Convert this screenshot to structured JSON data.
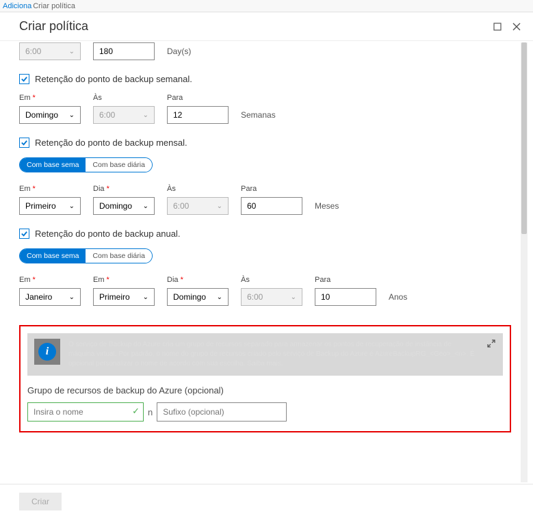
{
  "breadcrumb": {
    "prev": "Adiciona",
    "current": "Criar política"
  },
  "header": {
    "title": "Criar política"
  },
  "daily": {
    "time": "6:00",
    "days": "180",
    "unit": "Day(s)"
  },
  "weekly": {
    "title": "Retenção do ponto de backup semanal.",
    "em_label": "Em",
    "em_value": "Domingo",
    "as_label": "Às",
    "as_value": "6:00",
    "para_label": "Para",
    "para_value": "12",
    "unit": "Semanas"
  },
  "monthly": {
    "title": "Retenção do ponto de backup mensal.",
    "pill_weekly": "Com base sema",
    "pill_daily": "Com base diária",
    "em_label": "Em",
    "em_value": "Primeiro",
    "dia_label": "Dia",
    "dia_value": "Domingo",
    "as_label": "Às",
    "as_value": "6:00",
    "para_label": "Para",
    "para_value": "60",
    "unit": "Meses"
  },
  "yearly": {
    "title": "Retenção do ponto de backup anual.",
    "pill_weekly": "Com base sema",
    "pill_daily": "Com base diária",
    "em_label": "Em",
    "em_value": "Janeiro",
    "em2_label": "Em",
    "em2_value": "Primeiro",
    "dia_label": "Dia",
    "dia_value": "Domingo",
    "as_label": "Às",
    "as_value": "6:00",
    "para_label": "Para",
    "para_value": "10",
    "unit": "Anos"
  },
  "info": {
    "text": "O serviço de Backup do Azure cria um grupo de recursos separado para armazenar os pontos de recuperação de instância de máquina virtual. Por padrão, o nome do grupo de recursos criado pelo serviço de Backup do Azure é AzureBackupRG_<Geo>_<n>. É opcional personalizar o nome de acordo com sua escolha. Saiba mais."
  },
  "rg": {
    "section_label": "Grupo de recursos de backup do Azure (opcional)",
    "name_placeholder": "Insira o nome",
    "sep": "n",
    "suffix_placeholder": "Sufixo (opcional)"
  },
  "footer": {
    "create": "Criar"
  }
}
